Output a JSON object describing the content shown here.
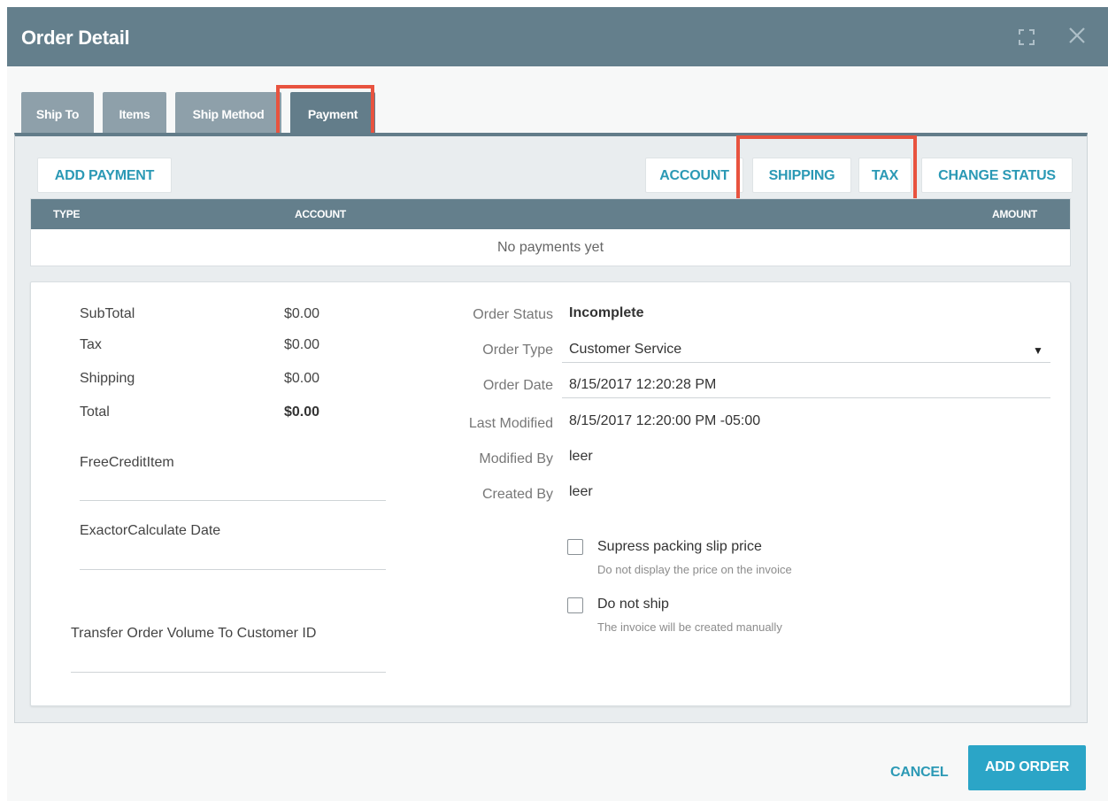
{
  "window": {
    "title": "Order Detail",
    "icons": {
      "expand": "expand-icon",
      "close": "close-icon"
    }
  },
  "tabs": [
    {
      "label": "Ship To"
    },
    {
      "label": "Items"
    },
    {
      "label": "Ship Method"
    },
    {
      "label": "Payment",
      "active": true
    }
  ],
  "toolbar": {
    "add_payment": "ADD PAYMENT",
    "account": "ACCOUNT",
    "shipping": "SHIPPING",
    "tax": "TAX",
    "change_status": "CHANGE STATUS"
  },
  "payments_table": {
    "columns": [
      "TYPE",
      "ACCOUNT",
      "AMOUNT"
    ],
    "empty_text": "No payments yet"
  },
  "totals": [
    {
      "label": "SubTotal",
      "value": "$0.00"
    },
    {
      "label": "Tax",
      "value": "$0.00"
    },
    {
      "label": "Shipping",
      "value": "$0.00"
    },
    {
      "label": "Total",
      "value": "$0.00"
    }
  ],
  "fields": {
    "free_credit_item": "FreeCreditItem",
    "exactor_calculate_date": "ExactorCalculate Date",
    "transfer_order_volume": "Transfer Order Volume To Customer ID"
  },
  "order_info": {
    "status_label": "Order Status",
    "status_value": "Incomplete",
    "type_label": "Order Type",
    "type_value": "Customer Service",
    "date_label": "Order Date",
    "date_value": "8/15/2017 12:20:28 PM",
    "last_modified_label": "Last Modified",
    "last_modified_value": "8/15/2017 12:20:00 PM -05:00",
    "modified_by_label": "Modified By",
    "modified_by_value": "leer",
    "created_by_label": "Created By",
    "created_by_value": "leer"
  },
  "options": [
    {
      "label": "Supress packing slip price",
      "help": "Do not display the price on the invoice",
      "checked": false
    },
    {
      "label": "Do not ship",
      "help": "The invoice will be created manually",
      "checked": false
    }
  ],
  "footer": {
    "cancel": "CANCEL",
    "add_order": "ADD ORDER"
  },
  "colors": {
    "titlebar": "#647f8c",
    "accent": "#2b99b5",
    "primary_button": "#2ba5c7",
    "highlight": "#e8533f"
  }
}
